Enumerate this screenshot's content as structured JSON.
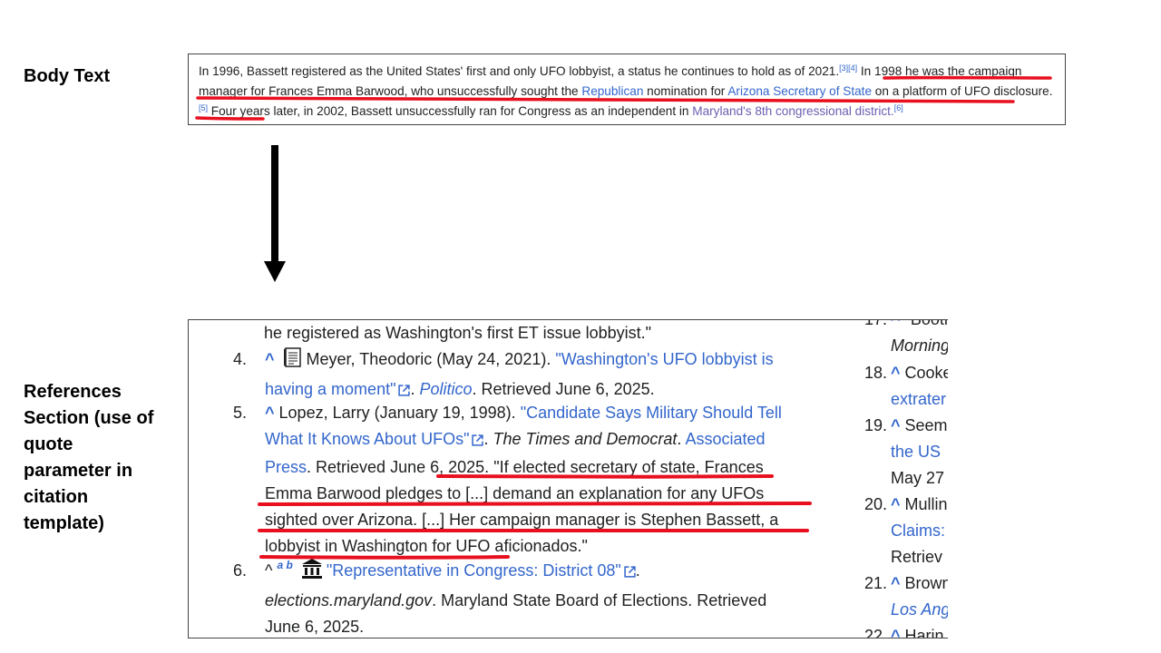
{
  "labels": {
    "body": "Body Text",
    "refs": "References Section (use of quote parameter in citation template)"
  },
  "body": {
    "p1": "In 1996, Bassett registered as the United States' first and only UFO lobbyist, a status he continues to hold as of 2021.",
    "sup1": "[3][4]",
    "p2": " In 1998 he was the campaign manager for Frances Emma Barwood, who unsuccessfully sought the ",
    "link1": "Republican",
    "p3": " nomination for ",
    "link2": "Arizona Secretary of State",
    "p4": " on a platform of UFO disclosure.",
    "sup2": "[5]",
    "p5": " Four years later, in 2002, Bassett unsuccessfully ran for Congress as an independent in ",
    "link3": "Maryland's 8th congressional district.",
    "sup3": "[6]"
  },
  "refs": {
    "r3_tail": "he registered as Washington's first ET issue lobbyist.\"",
    "r4": {
      "num": "4.",
      "caret": "^",
      "author": "Meyer, Theodoric (May 24, 2021).",
      "title": "\"Washington's UFO lobbyist is having a moment\"",
      "work": "Politico",
      "retrieved": ". Retrieved June 6, 2025."
    },
    "r5": {
      "num": "5.",
      "caret": "^",
      "author": "Lopez, Larry (January 19, 1998).",
      "title": "\"Candidate Says Military Should Tell What It Knows About UFOs\"",
      "work": "The Times and Democrat",
      "publisher": "Associated Press",
      "retrieved": "Retrieved June 6, 2025.",
      "quote": "\"If elected secretary of state, Frances Emma Barwood pledges to [...] demand an explanation for any UFOs sighted over Arizona. [...] Her campaign manager is Stephen Bassett, a lobbyist in Washington for UFO aficionados.\""
    },
    "r6": {
      "num": "6.",
      "caret": "^",
      "letters": "a b",
      "title": "\"Representative in Congress: District 08\"",
      "work": "elections.maryland.gov",
      "publisher": ". Maryland State Board of Elections. Retrieved June 6, 2025."
    },
    "col2": [
      {
        "n": "17.",
        "t": "^ \"Booth"
      },
      {
        "n": "",
        "t": "Morning"
      },
      {
        "n": "18.",
        "t": "^ Cooke"
      },
      {
        "n": "",
        "t": "extrater"
      },
      {
        "n": "19.",
        "t": "^ Seem"
      },
      {
        "n": "",
        "t": "the US"
      },
      {
        "n": "",
        "t": "May 27"
      },
      {
        "n": "20.",
        "t": "^ Mullin"
      },
      {
        "n": "",
        "t": "Claims:"
      },
      {
        "n": "",
        "t": "Retriev"
      },
      {
        "n": "21.",
        "t": "^ Brown"
      },
      {
        "n": "",
        "t": "Los Ang"
      },
      {
        "n": "22.",
        "t": "^ Harin"
      }
    ]
  },
  "colors": {
    "link": "#3366cc",
    "underline": "#e8101f",
    "arrow": "#000000"
  }
}
